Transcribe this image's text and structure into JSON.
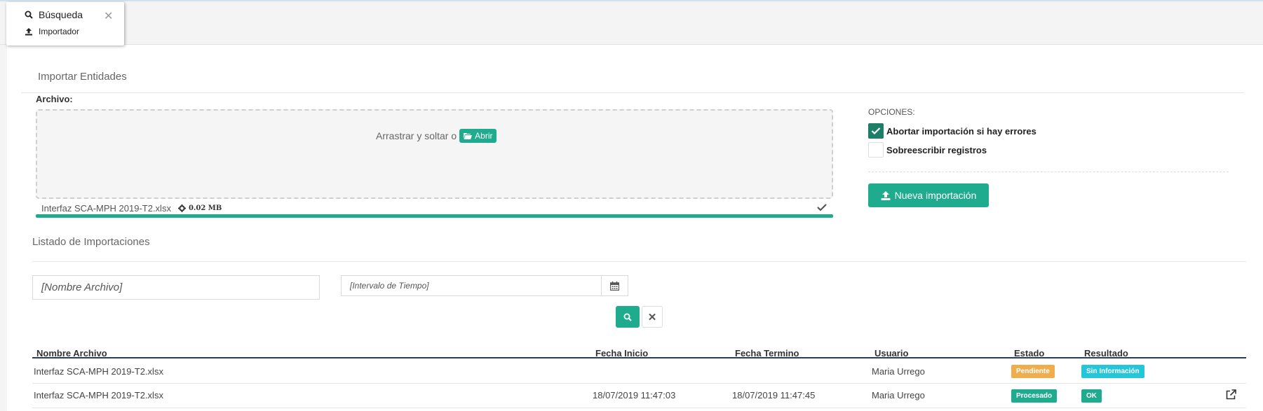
{
  "tabs": [
    {
      "label": "Búsqueda",
      "icon": "search-icon"
    },
    {
      "label": "Importador",
      "icon": "upload-icon"
    }
  ],
  "import_section": {
    "title": "Importar Entidades",
    "file_label": "Archivo:",
    "drop_text": "Arrastrar y soltar o",
    "open_button": "Abrir",
    "file_name": "Interfaz SCA-MPH 2019-T2.xlsx",
    "file_size": "0.02 MB",
    "progress": 1.0
  },
  "options": {
    "header": "OPCIONES:",
    "abort_label": "Abortar importación si hay errores",
    "abort_checked": true,
    "overwrite_label": "Sobreescribir registros",
    "overwrite_checked": false,
    "new_import_button": "Nueva importación"
  },
  "list_section": {
    "title": "Listado de Importaciones",
    "filename_placeholder": "[Nombre Archivo]",
    "interval_placeholder": "[Intervalo de Tiempo]"
  },
  "table": {
    "headers": [
      "Nombre Archivo",
      "Fecha Inicio",
      "Fecha Termino",
      "Usuario",
      "Estado",
      "Resultado"
    ],
    "rows": [
      {
        "file": "Interfaz SCA-MPH 2019-T2.xlsx",
        "start": "",
        "end": "",
        "user": "Maria Urrego",
        "status": "Pendiente",
        "result": "Sin Información"
      },
      {
        "file": "Interfaz SCA-MPH 2019-T2.xlsx",
        "start": "18/07/2019 11:47:03",
        "end": "18/07/2019 11:47:45",
        "user": "Maria Urrego",
        "status": "Procesado",
        "result": "OK"
      }
    ]
  },
  "colors": {
    "accent": "#1fac8e",
    "pending": "#f0ad4e",
    "info": "#26c6da",
    "checkbox_on": "#1f7e67"
  }
}
